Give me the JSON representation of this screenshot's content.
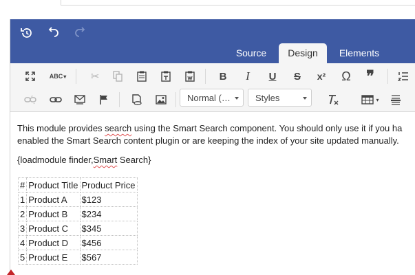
{
  "header": {
    "tabs": [
      {
        "label": "Source"
      },
      {
        "label": "Design"
      },
      {
        "label": "Elements"
      }
    ],
    "active_tab": "Design"
  },
  "toolbar": {
    "format_select": "Normal (…",
    "styles_select": "Styles",
    "bold": "B",
    "italic": "I",
    "underline": "U",
    "strike": "S",
    "superscript": "x²",
    "omega": "Ω",
    "quote": "❞",
    "spell": "ABC"
  },
  "content": {
    "para1_a": "This module provides ",
    "para1_b": "search",
    "para1_c": " using the Smart Search component. You should only use it if you ha",
    "para2": "enabled the Smart Search content plugin or are keeping the index of your site updated manually.",
    "loadmodule_a": "{loadmodule finder,",
    "loadmodule_b": "Smart",
    "loadmodule_c": " Search}"
  },
  "table": {
    "headers": [
      "#",
      "Product Title",
      "Product Price"
    ],
    "rows": [
      [
        "1",
        "Product A",
        "$123"
      ],
      [
        "2",
        "Product B",
        "$234"
      ],
      [
        "3",
        "Product C",
        "$345"
      ],
      [
        "4",
        "Product D",
        "$456"
      ],
      [
        "5",
        "Product E",
        "$567"
      ]
    ]
  },
  "colors": {
    "header_bg": "#3e5aa3",
    "toolbar_bg": "#f5f5f5",
    "spell_underline": "#e05050"
  }
}
